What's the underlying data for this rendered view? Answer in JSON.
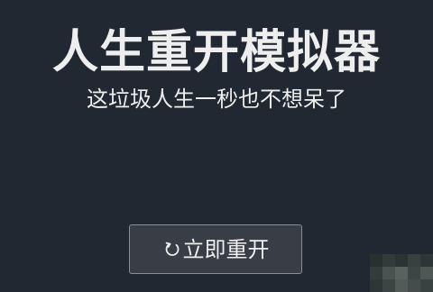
{
  "header": {
    "title": "人生重开模拟器",
    "subtitle": "这垃圾人生一秒也不想呆了"
  },
  "restart_button": {
    "label": "立即重开",
    "icon": "restart-icon"
  },
  "colors": {
    "background": "#222831",
    "button_background": "#393e46",
    "text": "#eeeeee"
  }
}
